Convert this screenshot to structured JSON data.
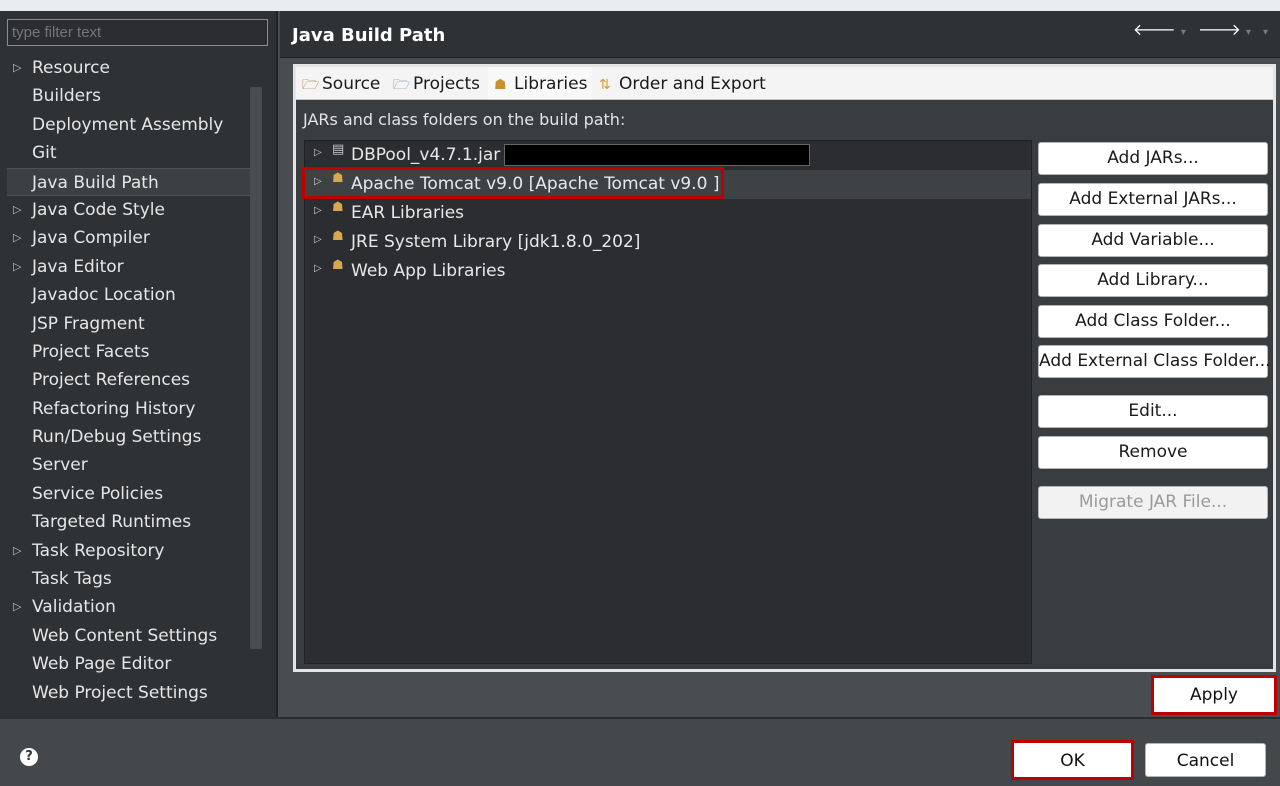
{
  "filter": {
    "placeholder": "type filter text"
  },
  "tree": {
    "items": [
      {
        "label": "Resource",
        "expandable": true
      },
      {
        "label": "Builders",
        "expandable": false
      },
      {
        "label": "Deployment Assembly",
        "expandable": false
      },
      {
        "label": "Git",
        "expandable": false
      },
      {
        "label": "Java Build Path",
        "expandable": false,
        "selected": true
      },
      {
        "label": "Java Code Style",
        "expandable": true
      },
      {
        "label": "Java Compiler",
        "expandable": true
      },
      {
        "label": "Java Editor",
        "expandable": true
      },
      {
        "label": "Javadoc Location",
        "expandable": false
      },
      {
        "label": "JSP Fragment",
        "expandable": false
      },
      {
        "label": "Project Facets",
        "expandable": false
      },
      {
        "label": "Project References",
        "expandable": false
      },
      {
        "label": "Refactoring History",
        "expandable": false
      },
      {
        "label": "Run/Debug Settings",
        "expandable": false
      },
      {
        "label": "Server",
        "expandable": false
      },
      {
        "label": "Service Policies",
        "expandable": false
      },
      {
        "label": "Targeted Runtimes",
        "expandable": false
      },
      {
        "label": "Task Repository",
        "expandable": true
      },
      {
        "label": "Task Tags",
        "expandable": false
      },
      {
        "label": "Validation",
        "expandable": true
      },
      {
        "label": "Web Content Settings",
        "expandable": false
      },
      {
        "label": "Web Page Editor",
        "expandable": false
      },
      {
        "label": "Web Project Settings",
        "expandable": false
      }
    ]
  },
  "header": {
    "title": "Java Build Path"
  },
  "tabs": [
    {
      "label": "Source",
      "icon": "source-folder-icon"
    },
    {
      "label": "Projects",
      "icon": "projects-folder-icon"
    },
    {
      "label": "Libraries",
      "icon": "libraries-icon",
      "active": true
    },
    {
      "label": "Order and Export",
      "icon": "order-export-icon"
    }
  ],
  "libraries": {
    "description": "JARs and class folders on the build path:",
    "entries": [
      {
        "label": "DBPool_v4.7.1.jar",
        "icon": "jar-icon",
        "redacted": true
      },
      {
        "label": "Apache Tomcat v9.0 [Apache Tomcat v9.0 ]",
        "icon": "library-icon",
        "selected": true
      },
      {
        "label": "EAR Libraries",
        "icon": "library-icon"
      },
      {
        "label": "JRE System Library [jdk1.8.0_202]",
        "icon": "library-icon"
      },
      {
        "label": "Web App Libraries",
        "icon": "library-icon"
      }
    ]
  },
  "buttons": {
    "add_jars": "Add JARs...",
    "add_external_jars": "Add External JARs...",
    "add_variable": "Add Variable...",
    "add_library": "Add Library...",
    "add_class_folder": "Add Class Folder...",
    "add_external_class_folder": "Add External Class Folder...",
    "edit": "Edit...",
    "remove": "Remove",
    "migrate_jar": "Migrate JAR File...",
    "apply": "Apply",
    "ok": "OK",
    "cancel": "Cancel"
  },
  "colors": {
    "highlight": "#c00000"
  }
}
